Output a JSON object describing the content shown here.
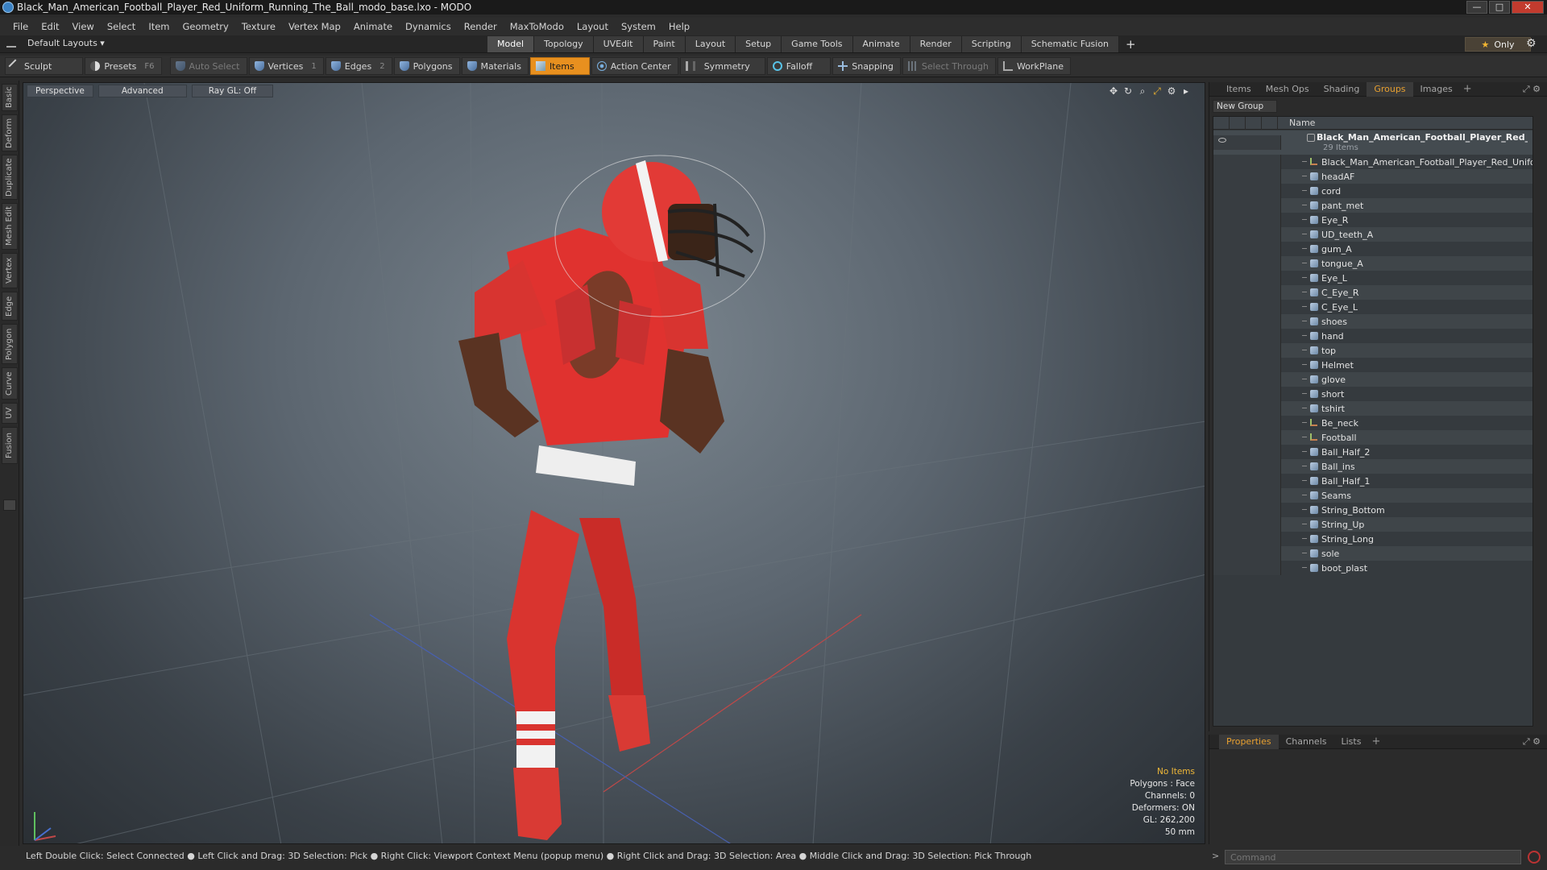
{
  "window": {
    "title": "Black_Man_American_Football_Player_Red_Uniform_Running_The_Ball_modo_base.lxo - MODO",
    "minimize": "—",
    "maximize": "□",
    "close": "✕"
  },
  "menu": [
    "File",
    "Edit",
    "View",
    "Select",
    "Item",
    "Geometry",
    "Texture",
    "Vertex Map",
    "Animate",
    "Dynamics",
    "Render",
    "MaxToModo",
    "Layout",
    "System",
    "Help"
  ],
  "layout": {
    "selector": "Default Layouts ▾",
    "tabs": [
      "Model",
      "Topology",
      "UVEdit",
      "Paint",
      "Layout",
      "Setup",
      "Game Tools",
      "Animate",
      "Render",
      "Scripting",
      "Schematic Fusion"
    ],
    "active_tab": "Model",
    "add": "+",
    "only_label": "Only",
    "only_star": "★",
    "gear": "⚙"
  },
  "toolbar": {
    "sculpt": "Sculpt",
    "presets": "Presets",
    "presets_key": "F6",
    "auto_select": "Auto Select",
    "vertices": "Vertices",
    "vertices_key": "1",
    "edges": "Edges",
    "edges_key": "2",
    "polygons": "Polygons",
    "materials": "Materials",
    "items": "Items",
    "action_center": "Action Center",
    "symmetry": "Symmetry",
    "falloff": "Falloff",
    "snapping": "Snapping",
    "select_through": "Select Through",
    "workplane": "WorkPlane"
  },
  "left_tabs": [
    "Basic",
    "Deform",
    "Duplicate",
    "Mesh Edit",
    "Vertex",
    "Edge",
    "Polygon",
    "Curve",
    "UV",
    "Fusion"
  ],
  "viewport": {
    "perspective": "Perspective",
    "advanced": "Advanced",
    "raygl": "Ray GL: Off",
    "stats": {
      "no_items": "No Items",
      "polygons": "Polygons : Face",
      "channels": "Channels: 0",
      "deformers": "Deformers: ON",
      "gl": "GL: 262,200",
      "focal": "50 mm"
    }
  },
  "statusbar": "Left Double Click: Select Connected ● Left Click and Drag: 3D Selection: Pick ● Right Click: Viewport Context Menu (popup menu) ● Right Click and Drag: 3D Selection: Area ● Middle Click and Drag: 3D Selection: Pick Through",
  "right_panel": {
    "tabs": [
      "Items",
      "Mesh Ops",
      "Shading",
      "Groups",
      "Images"
    ],
    "active_tab": "Groups",
    "add": "+",
    "new_group": "New Group",
    "name_header": "Name",
    "group_name": "Black_Man_American_Football_Player_Red_ ...",
    "group_count": "29 Items",
    "items": [
      {
        "label": "Black_Man_American_Football_Player_Red_Uniform...",
        "kind": "locator"
      },
      {
        "label": "headAF",
        "kind": "mesh"
      },
      {
        "label": "cord",
        "kind": "mesh"
      },
      {
        "label": "pant_met",
        "kind": "mesh"
      },
      {
        "label": "Eye_R",
        "kind": "mesh"
      },
      {
        "label": "UD_teeth_A",
        "kind": "mesh"
      },
      {
        "label": "gum_A",
        "kind": "mesh"
      },
      {
        "label": "tongue_A",
        "kind": "mesh"
      },
      {
        "label": "Eye_L",
        "kind": "mesh"
      },
      {
        "label": "C_Eye_R",
        "kind": "mesh"
      },
      {
        "label": "C_Eye_L",
        "kind": "mesh"
      },
      {
        "label": "shoes",
        "kind": "mesh"
      },
      {
        "label": "hand",
        "kind": "mesh"
      },
      {
        "label": "top",
        "kind": "mesh"
      },
      {
        "label": "Helmet",
        "kind": "mesh"
      },
      {
        "label": "glove",
        "kind": "mesh"
      },
      {
        "label": "short",
        "kind": "mesh"
      },
      {
        "label": "tshirt",
        "kind": "mesh"
      },
      {
        "label": "Be_neck",
        "kind": "locator"
      },
      {
        "label": "Football",
        "kind": "locator"
      },
      {
        "label": "Ball_Half_2",
        "kind": "mesh"
      },
      {
        "label": "Ball_ins",
        "kind": "mesh"
      },
      {
        "label": "Ball_Half_1",
        "kind": "mesh"
      },
      {
        "label": "Seams",
        "kind": "mesh"
      },
      {
        "label": "String_Bottom",
        "kind": "mesh"
      },
      {
        "label": "String_Up",
        "kind": "mesh"
      },
      {
        "label": "String_Long",
        "kind": "mesh"
      },
      {
        "label": "sole",
        "kind": "mesh"
      },
      {
        "label": "boot_plast",
        "kind": "mesh"
      }
    ]
  },
  "props_panel": {
    "tabs": [
      "Properties",
      "Channels",
      "Lists"
    ],
    "active_tab": "Properties",
    "add": "+"
  },
  "command": {
    "placeholder": "Command",
    "arrow": ">"
  },
  "colors": {
    "accent": "#e8901f",
    "active_tab_text": "#e8a030",
    "jersey_red": "#e0322f"
  }
}
